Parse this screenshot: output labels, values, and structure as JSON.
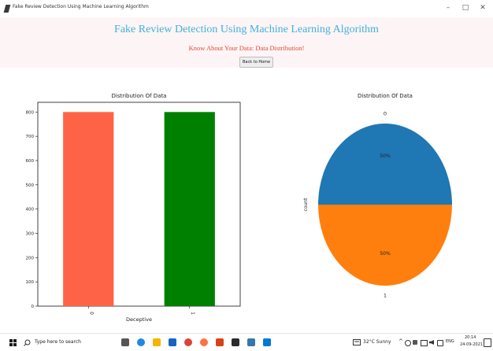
{
  "window": {
    "title": "Fake Review Detection Using Machine Learning Algorithm",
    "minimize": "–",
    "restore": "□",
    "close": "✕"
  },
  "header": {
    "title": "Fake Review Detection Using Machine Learning Algorithm",
    "subtitle": "Know About Your Data: Data Distribution!",
    "back_button": "Back to Home"
  },
  "colors": {
    "title": "#41b1df",
    "subtitle": "#e2473e",
    "bar_0": "#ff6347",
    "bar_1": "#008000",
    "pie_0": "#1f77b4",
    "pie_1": "#ff7f0e"
  },
  "chart_data": [
    {
      "type": "bar",
      "title": "Distribution Of Data",
      "categories": [
        "0",
        "1"
      ],
      "values": [
        800,
        800
      ],
      "xlabel": "Deceptive",
      "ylabel": "",
      "ylim": [
        0,
        840
      ],
      "yticks": [
        0,
        100,
        200,
        300,
        400,
        500,
        600,
        700,
        800
      ],
      "grid": false
    },
    {
      "type": "pie",
      "title": "Distribution Of Data",
      "labels": [
        "0",
        "1"
      ],
      "values": [
        50,
        50
      ],
      "pct_labels": [
        "50%",
        "50%"
      ],
      "ylabel": "count"
    }
  ],
  "taskbar": {
    "search_placeholder": "Type here to search",
    "weather": "32°C Sunny",
    "lang": "ENG",
    "time": "20:14",
    "date": "24-09-2021",
    "app_icons": [
      "task-view-icon",
      "edge-icon",
      "file-explorer-icon",
      "mail-icon",
      "chrome-icon",
      "firefox-icon",
      "office-icon",
      "terminal-icon",
      "python-icon",
      "photos-icon"
    ]
  }
}
